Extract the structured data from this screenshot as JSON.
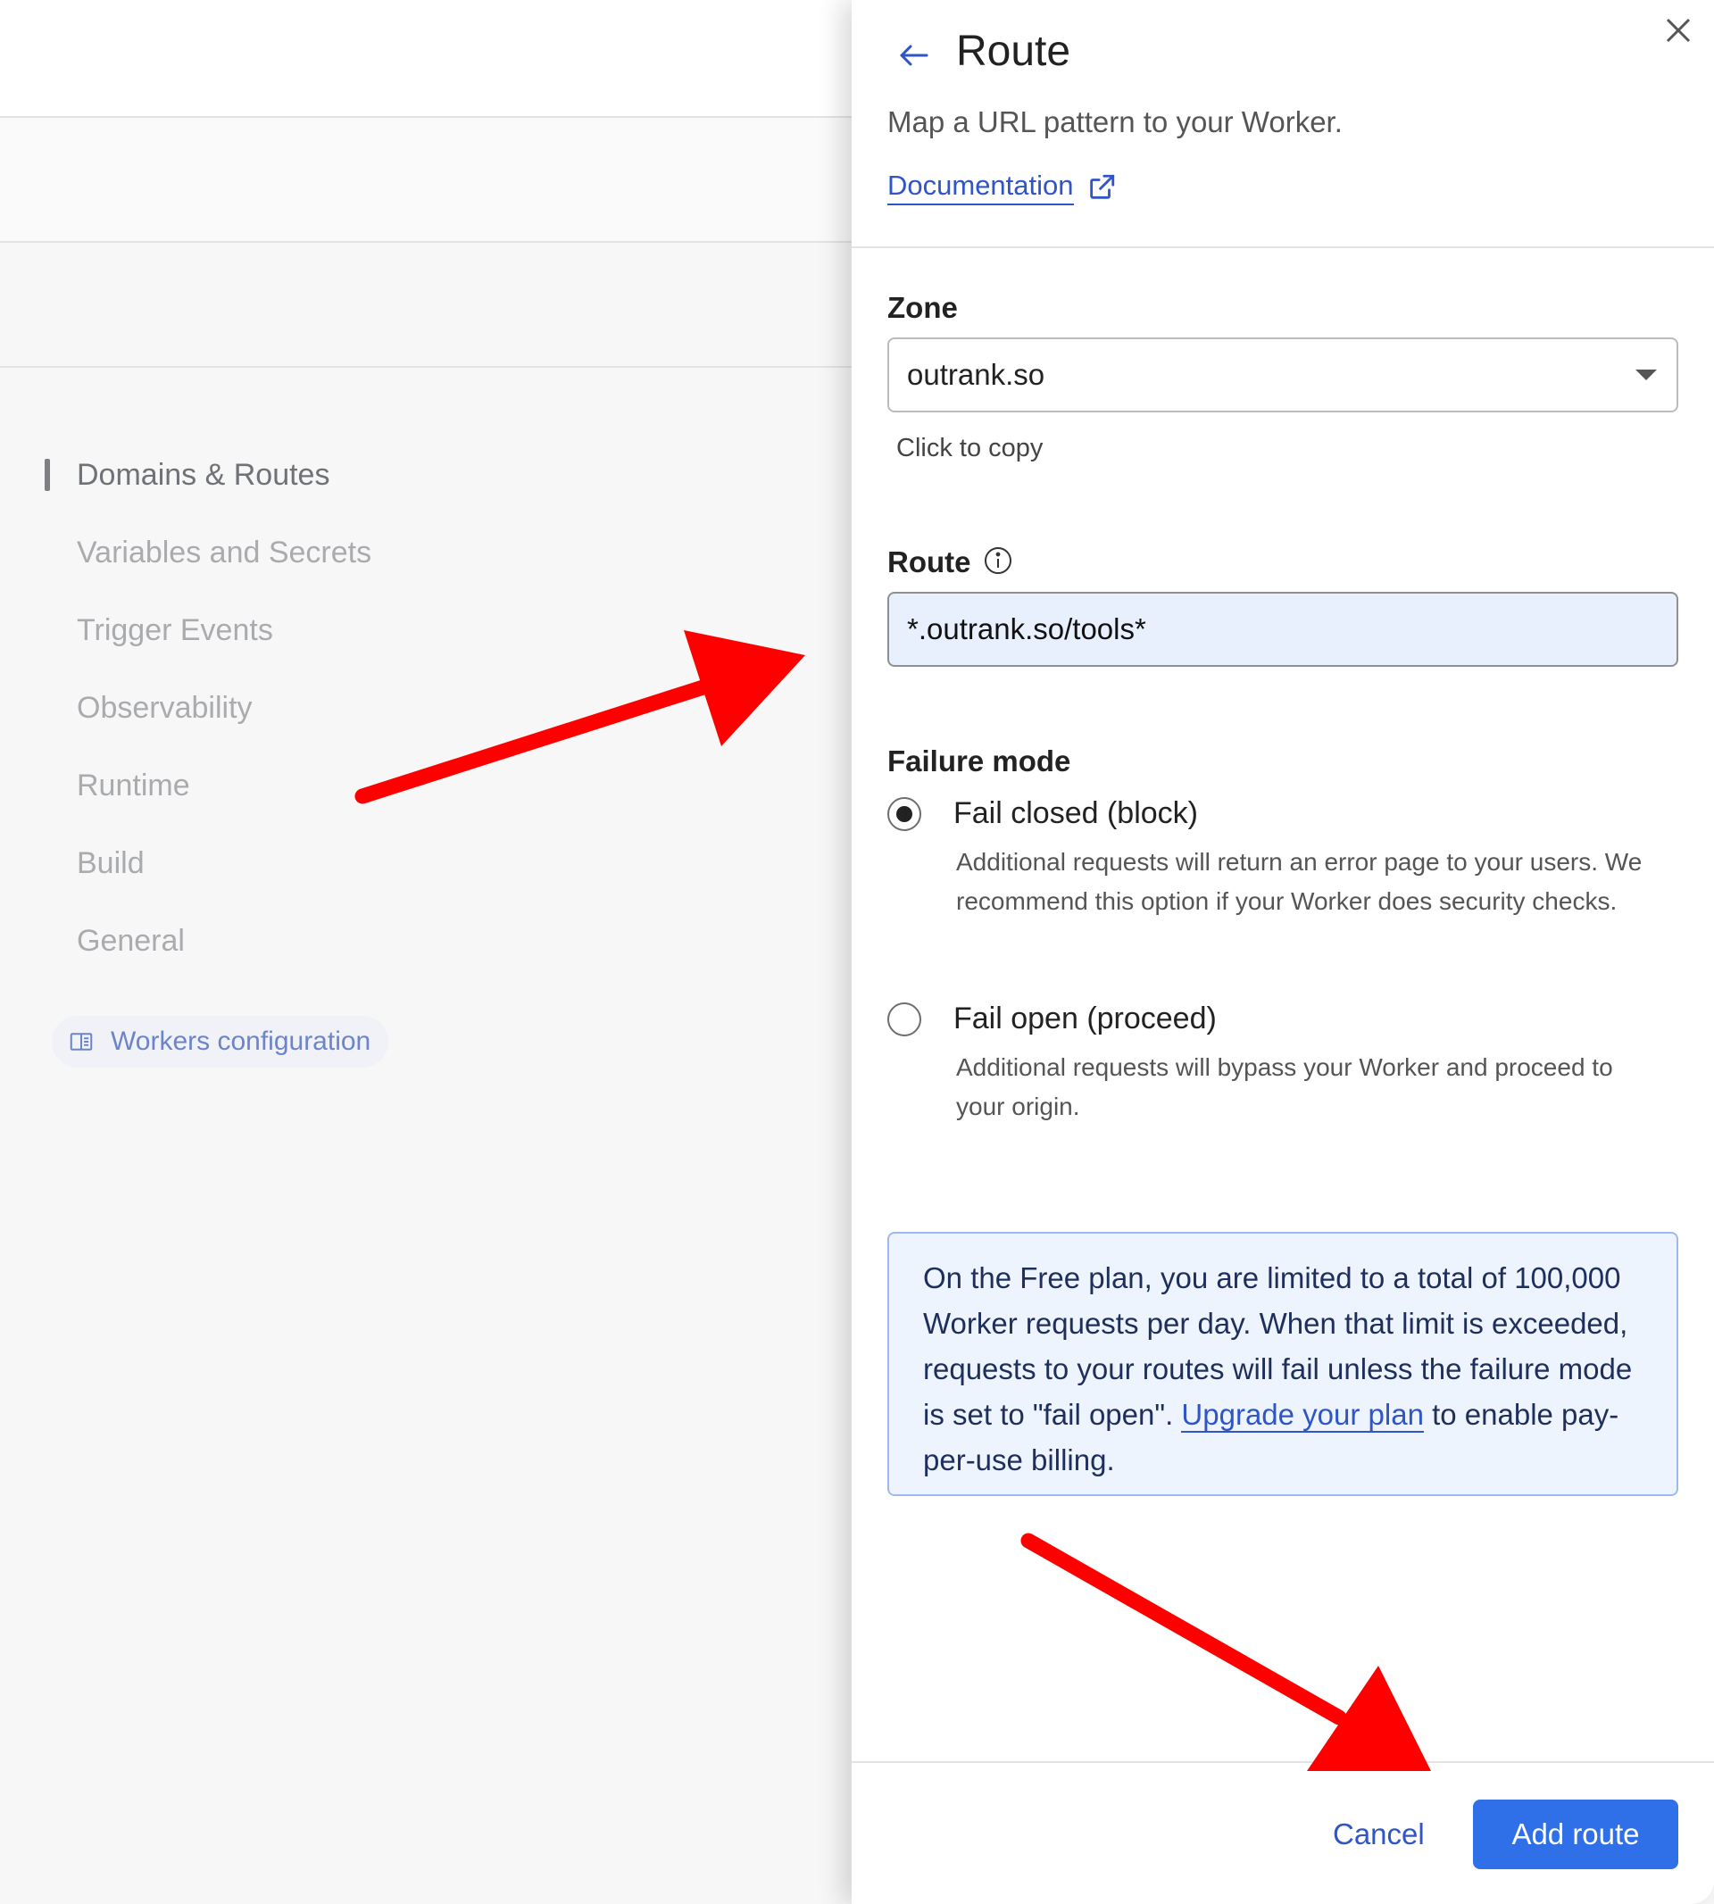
{
  "sidebar": {
    "items": [
      {
        "label": "Domains & Routes",
        "active": true
      },
      {
        "label": "Variables and Secrets",
        "active": false
      },
      {
        "label": "Trigger Events",
        "active": false
      },
      {
        "label": "Observability",
        "active": false
      },
      {
        "label": "Runtime",
        "active": false
      },
      {
        "label": "Build",
        "active": false
      },
      {
        "label": "General",
        "active": false
      }
    ],
    "config_link": {
      "label": "Workers configuration",
      "icon": "book-icon"
    }
  },
  "drawer": {
    "title": "Route",
    "subtitle": "Map a URL pattern to your Worker.",
    "doc_link": {
      "label": "Documentation",
      "icon": "external-link-icon"
    },
    "zone": {
      "label": "Zone",
      "value": "outrank.so",
      "hint": "Click to copy"
    },
    "route": {
      "label": "Route",
      "value": "*.outrank.so/tools*",
      "info_icon": "info-icon"
    },
    "failure_mode": {
      "label": "Failure mode",
      "options": [
        {
          "label": "Fail closed (block)",
          "checked": true,
          "description": "Additional requests will return an error page to your users. We recommend this option if your Worker does security checks."
        },
        {
          "label": "Fail open (proceed)",
          "checked": false,
          "description": "Additional requests will bypass your Worker and proceed to your origin."
        }
      ]
    },
    "notice": {
      "text_before": "On the Free plan, you are limited to a total of 100,000 Worker requests per day. When that limit is exceeded, requests to your routes will fail unless the failure mode is set to \"fail open\". ",
      "link": "Upgrade your plan",
      "text_after": " to enable pay-per-use billing."
    },
    "actions": {
      "cancel": "Cancel",
      "submit": "Add route"
    }
  },
  "colors": {
    "accent": "#2f6fe8",
    "link": "#2f55c6",
    "annotation_arrow": "#ff0000",
    "notice_bg": "#eef4fd",
    "input_highlight": "#e8effd"
  }
}
